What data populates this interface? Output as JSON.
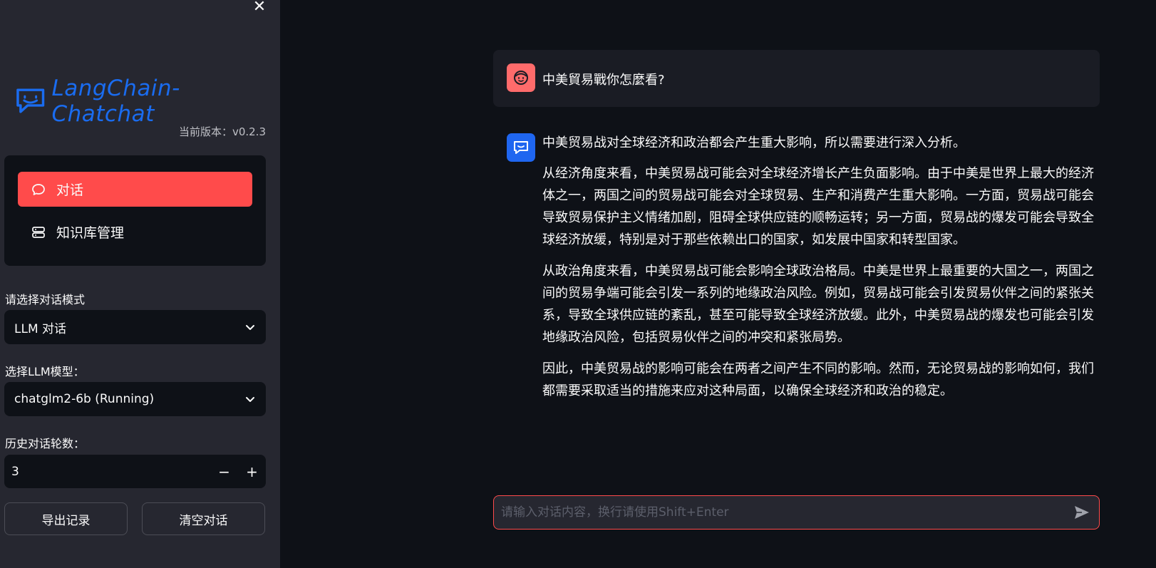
{
  "sidebar": {
    "logo_text": "LangChain-Chatchat",
    "version": "当前版本：v0.2.3",
    "nav": [
      {
        "label": "对话",
        "icon": "chat-bubble-icon",
        "active": true
      },
      {
        "label": "知识库管理",
        "icon": "database-icon",
        "active": false
      }
    ],
    "mode_label": "请选择对话模式",
    "mode_value": "LLM 对话",
    "model_label": "选择LLM模型：",
    "model_value": "chatglm2-6b (Running)",
    "history_label": "历史对话轮数：",
    "history_value": "3",
    "export_label": "导出记录",
    "clear_label": "清空对话"
  },
  "chat": {
    "user_message": "中美貿易戰你怎麼看?",
    "bot_paragraphs": [
      "中美贸易战对全球经济和政治都会产生重大影响，所以需要进行深入分析。",
      "从经济角度来看，中美贸易战可能会对全球经济增长产生负面影响。由于中美是世界上最大的经济体之一，两国之间的贸易战可能会对全球贸易、生产和消费产生重大影响。一方面，贸易战可能会导致贸易保护主义情绪加剧，阻碍全球供应链的顺畅运转；另一方面，贸易战的爆发可能会导致全球经济放缓，特别是对于那些依赖出口的国家，如发展中国家和转型国家。",
      "从政治角度来看，中美贸易战可能会影响全球政治格局。中美是世界上最重要的大国之一，两国之间的贸易争端可能会引发一系列的地缘政治风险。例如，贸易战可能会引发贸易伙伴之间的紧张关系，导致全球供应链的紊乱，甚至可能导致全球经济放缓。此外，中美贸易战的爆发也可能会引发地缘政治风险，包括贸易伙伴之间的冲突和紧张局势。",
      "因此，中美贸易战的影响可能会在两者之间产生不同的影响。然而，无论贸易战的影响如何，我们都需要采取适当的措施来应对这种局面，以确保全球经济和政治的稳定。"
    ],
    "input_placeholder": "请输入对话内容，换行请使用Shift+Enter"
  },
  "colors": {
    "accent": "#ff4b4b",
    "brand": "#1a6cf0",
    "sidebar_bg": "#262730",
    "main_bg": "#0e1117"
  }
}
